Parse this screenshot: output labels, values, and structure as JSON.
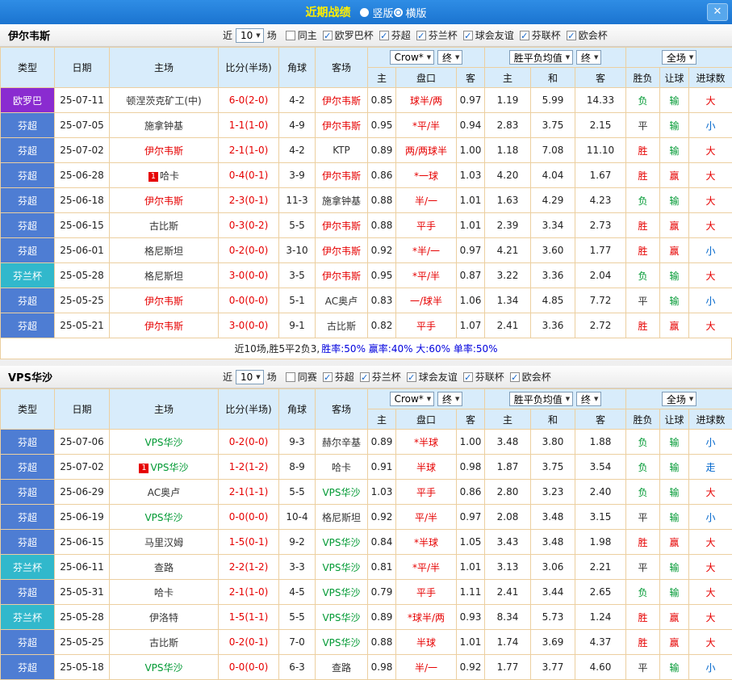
{
  "titlebar": {
    "title": "近期战绩",
    "close_glyph": "✕",
    "radios": [
      {
        "label": "竖版",
        "selected": false
      },
      {
        "label": "横版",
        "selected": true
      }
    ]
  },
  "colors": {
    "type": {
      "欧罗巴": "#8a2bd0",
      "芬超": "#4e7dd3",
      "芬兰杯": "#31b8cc"
    },
    "result": {
      "胜": "#e60000",
      "平": "#333333",
      "负": "#009933",
      "赢": "#e60000",
      "输": "#009933",
      "走": "#0066cc",
      "大": "#e60000",
      "小": "#0066cc"
    },
    "score": "#e60000",
    "handicap": "#e60000"
  },
  "table_header": {
    "type": "类型",
    "date": "日期",
    "home": "主场",
    "score": "比分(半场)",
    "corners": "角球",
    "away": "客场",
    "odds_company": "Crow*",
    "final1": "终",
    "odds_home": "主",
    "odds_handicap": "盘口",
    "odds_away": "客",
    "avg_company": "胜平负均值",
    "final2": "终",
    "avg_home": "主",
    "avg_draw": "和",
    "avg_away": "客",
    "fullmatch": "全场",
    "res_wdl": "胜负",
    "res_handicap": "让球",
    "res_goals": "进球数"
  },
  "sections": [
    {
      "team": "伊尔韦斯",
      "focus_color": "#e60000",
      "near_label": "近",
      "count_value": "10",
      "matches_label": "场",
      "filters": [
        {
          "label": "同主",
          "checked": false
        },
        {
          "label": "欧罗巴杯",
          "checked": true
        },
        {
          "label": "芬超",
          "checked": true
        },
        {
          "label": "芬兰杯",
          "checked": true
        },
        {
          "label": "球会友谊",
          "checked": true
        },
        {
          "label": "芬联杯",
          "checked": true
        },
        {
          "label": "欧会杯",
          "checked": true
        }
      ],
      "rows": [
        {
          "type": "欧罗巴",
          "date": "25-07-11",
          "home": "顿涅茨克矿工(中)",
          "home_badge": "",
          "home_focus": false,
          "score": "6-0(2-0)",
          "corners": "4-2",
          "away": "伊尔韦斯",
          "away_focus": true,
          "o_home": "0.85",
          "handicap": "球半/两",
          "o_away": "0.97",
          "a_home": "1.19",
          "a_draw": "5.99",
          "a_away": "14.33",
          "r_wdl": "负",
          "r_let": "输",
          "r_goal": "大"
        },
        {
          "type": "芬超",
          "date": "25-07-05",
          "home": "施拿钟基",
          "home_badge": "",
          "home_focus": false,
          "score": "1-1(1-0)",
          "corners": "4-9",
          "away": "伊尔韦斯",
          "away_focus": true,
          "o_home": "0.95",
          "handicap": "*平/半",
          "o_away": "0.94",
          "a_home": "2.83",
          "a_draw": "3.75",
          "a_away": "2.15",
          "r_wdl": "平",
          "r_let": "输",
          "r_goal": "小"
        },
        {
          "type": "芬超",
          "date": "25-07-02",
          "home": "伊尔韦斯",
          "home_badge": "",
          "home_focus": true,
          "score": "2-1(1-0)",
          "corners": "4-2",
          "away": "KTP",
          "away_focus": false,
          "o_home": "0.89",
          "handicap": "两/两球半",
          "o_away": "1.00",
          "a_home": "1.18",
          "a_draw": "7.08",
          "a_away": "11.10",
          "r_wdl": "胜",
          "r_let": "输",
          "r_goal": "大"
        },
        {
          "type": "芬超",
          "date": "25-06-28",
          "home": "哈卡",
          "home_badge": "1",
          "home_focus": false,
          "score": "0-4(0-1)",
          "corners": "3-9",
          "away": "伊尔韦斯",
          "away_focus": true,
          "o_home": "0.86",
          "handicap": "*一球",
          "o_away": "1.03",
          "a_home": "4.20",
          "a_draw": "4.04",
          "a_away": "1.67",
          "r_wdl": "胜",
          "r_let": "赢",
          "r_goal": "大"
        },
        {
          "type": "芬超",
          "date": "25-06-18",
          "home": "伊尔韦斯",
          "home_badge": "",
          "home_focus": true,
          "score": "2-3(0-1)",
          "corners": "11-3",
          "away": "施拿钟基",
          "away_focus": false,
          "o_home": "0.88",
          "handicap": "半/一",
          "o_away": "1.01",
          "a_home": "1.63",
          "a_draw": "4.29",
          "a_away": "4.23",
          "r_wdl": "负",
          "r_let": "输",
          "r_goal": "大"
        },
        {
          "type": "芬超",
          "date": "25-06-15",
          "home": "古比斯",
          "home_badge": "",
          "home_focus": false,
          "score": "0-3(0-2)",
          "corners": "5-5",
          "away": "伊尔韦斯",
          "away_focus": true,
          "o_home": "0.88",
          "handicap": "平手",
          "o_away": "1.01",
          "a_home": "2.39",
          "a_draw": "3.34",
          "a_away": "2.73",
          "r_wdl": "胜",
          "r_let": "赢",
          "r_goal": "大"
        },
        {
          "type": "芬超",
          "date": "25-06-01",
          "home": "格尼斯坦",
          "home_badge": "",
          "home_focus": false,
          "score": "0-2(0-0)",
          "corners": "3-10",
          "away": "伊尔韦斯",
          "away_focus": true,
          "o_home": "0.92",
          "handicap": "*半/一",
          "o_away": "0.97",
          "a_home": "4.21",
          "a_draw": "3.60",
          "a_away": "1.77",
          "r_wdl": "胜",
          "r_let": "赢",
          "r_goal": "小"
        },
        {
          "type": "芬兰杯",
          "date": "25-05-28",
          "home": "格尼斯坦",
          "home_badge": "",
          "home_focus": false,
          "score": "3-0(0-0)",
          "corners": "3-5",
          "away": "伊尔韦斯",
          "away_focus": true,
          "o_home": "0.95",
          "handicap": "*平/半",
          "o_away": "0.87",
          "a_home": "3.22",
          "a_draw": "3.36",
          "a_away": "2.04",
          "r_wdl": "负",
          "r_let": "输",
          "r_goal": "大"
        },
        {
          "type": "芬超",
          "date": "25-05-25",
          "home": "伊尔韦斯",
          "home_badge": "",
          "home_focus": true,
          "score": "0-0(0-0)",
          "corners": "5-1",
          "away": "AC奥卢",
          "away_focus": false,
          "o_home": "0.83",
          "handicap": "一/球半",
          "o_away": "1.06",
          "a_home": "1.34",
          "a_draw": "4.85",
          "a_away": "7.72",
          "r_wdl": "平",
          "r_let": "输",
          "r_goal": "小"
        },
        {
          "type": "芬超",
          "date": "25-05-21",
          "home": "伊尔韦斯",
          "home_badge": "",
          "home_focus": true,
          "score": "3-0(0-0)",
          "corners": "9-1",
          "away": "古比斯",
          "away_focus": false,
          "o_home": "0.82",
          "handicap": "平手",
          "o_away": "1.07",
          "a_home": "2.41",
          "a_draw": "3.36",
          "a_away": "2.72",
          "r_wdl": "胜",
          "r_let": "赢",
          "r_goal": "大"
        }
      ],
      "summary_prefix": "近10场,胜5平2负3, ",
      "summary_stats": "胜率:50% 赢率:40% 大:60% 单率:50%"
    },
    {
      "team": "VPS华沙",
      "focus_color": "#009933",
      "near_label": "近",
      "count_value": "10",
      "matches_label": "场",
      "filters": [
        {
          "label": "同赛",
          "checked": false
        },
        {
          "label": "芬超",
          "checked": true
        },
        {
          "label": "芬兰杯",
          "checked": true
        },
        {
          "label": "球会友谊",
          "checked": true
        },
        {
          "label": "芬联杯",
          "checked": true
        },
        {
          "label": "欧会杯",
          "checked": true
        }
      ],
      "rows": [
        {
          "type": "芬超",
          "date": "25-07-06",
          "home": "VPS华沙",
          "home_badge": "",
          "home_focus": true,
          "score": "0-2(0-0)",
          "corners": "9-3",
          "away": "赫尔辛基",
          "away_focus": false,
          "o_home": "0.89",
          "handicap": "*半球",
          "o_away": "1.00",
          "a_home": "3.48",
          "a_draw": "3.80",
          "a_away": "1.88",
          "r_wdl": "负",
          "r_let": "输",
          "r_goal": "小"
        },
        {
          "type": "芬超",
          "date": "25-07-02",
          "home": "VPS华沙",
          "home_badge": "1",
          "home_focus": true,
          "score": "1-2(1-2)",
          "corners": "8-9",
          "away": "哈卡",
          "away_focus": false,
          "o_home": "0.91",
          "handicap": "半球",
          "o_away": "0.98",
          "a_home": "1.87",
          "a_draw": "3.75",
          "a_away": "3.54",
          "r_wdl": "负",
          "r_let": "输",
          "r_goal": "走"
        },
        {
          "type": "芬超",
          "date": "25-06-29",
          "home": "AC奥卢",
          "home_badge": "",
          "home_focus": false,
          "score": "2-1(1-1)",
          "corners": "5-5",
          "away": "VPS华沙",
          "away_focus": true,
          "o_home": "1.03",
          "handicap": "平手",
          "o_away": "0.86",
          "a_home": "2.80",
          "a_draw": "3.23",
          "a_away": "2.40",
          "r_wdl": "负",
          "r_let": "输",
          "r_goal": "大"
        },
        {
          "type": "芬超",
          "date": "25-06-19",
          "home": "VPS华沙",
          "home_badge": "",
          "home_focus": true,
          "score": "0-0(0-0)",
          "corners": "10-4",
          "away": "格尼斯坦",
          "away_focus": false,
          "o_home": "0.92",
          "handicap": "平/半",
          "o_away": "0.97",
          "a_home": "2.08",
          "a_draw": "3.48",
          "a_away": "3.15",
          "r_wdl": "平",
          "r_let": "输",
          "r_goal": "小"
        },
        {
          "type": "芬超",
          "date": "25-06-15",
          "home": "马里汉姆",
          "home_badge": "",
          "home_focus": false,
          "score": "1-5(0-1)",
          "corners": "9-2",
          "away": "VPS华沙",
          "away_focus": true,
          "o_home": "0.84",
          "handicap": "*半球",
          "o_away": "1.05",
          "a_home": "3.43",
          "a_draw": "3.48",
          "a_away": "1.98",
          "r_wdl": "胜",
          "r_let": "赢",
          "r_goal": "大"
        },
        {
          "type": "芬兰杯",
          "date": "25-06-11",
          "home": "查路",
          "home_badge": "",
          "home_focus": false,
          "score": "2-2(1-2)",
          "corners": "3-3",
          "away": "VPS华沙",
          "away_focus": true,
          "o_home": "0.81",
          "handicap": "*平/半",
          "o_away": "1.01",
          "a_home": "3.13",
          "a_draw": "3.06",
          "a_away": "2.21",
          "r_wdl": "平",
          "r_let": "输",
          "r_goal": "大"
        },
        {
          "type": "芬超",
          "date": "25-05-31",
          "home": "哈卡",
          "home_badge": "",
          "home_focus": false,
          "score": "2-1(1-0)",
          "corners": "4-5",
          "away": "VPS华沙",
          "away_focus": true,
          "o_home": "0.79",
          "handicap": "平手",
          "o_away": "1.11",
          "a_home": "2.41",
          "a_draw": "3.44",
          "a_away": "2.65",
          "r_wdl": "负",
          "r_let": "输",
          "r_goal": "大"
        },
        {
          "type": "芬兰杯",
          "date": "25-05-28",
          "home": "伊洛特",
          "home_badge": "",
          "home_focus": false,
          "score": "1-5(1-1)",
          "corners": "5-5",
          "away": "VPS华沙",
          "away_focus": true,
          "o_home": "0.89",
          "handicap": "*球半/两",
          "o_away": "0.93",
          "a_home": "8.34",
          "a_draw": "5.73",
          "a_away": "1.24",
          "r_wdl": "胜",
          "r_let": "赢",
          "r_goal": "大"
        },
        {
          "type": "芬超",
          "date": "25-05-25",
          "home": "古比斯",
          "home_badge": "",
          "home_focus": false,
          "score": "0-2(0-1)",
          "corners": "7-0",
          "away": "VPS华沙",
          "away_focus": true,
          "o_home": "0.88",
          "handicap": "半球",
          "o_away": "1.01",
          "a_home": "1.74",
          "a_draw": "3.69",
          "a_away": "4.37",
          "r_wdl": "胜",
          "r_let": "赢",
          "r_goal": "大"
        },
        {
          "type": "芬超",
          "date": "25-05-18",
          "home": "VPS华沙",
          "home_badge": "",
          "home_focus": true,
          "score": "0-0(0-0)",
          "corners": "6-3",
          "away": "查路",
          "away_focus": false,
          "o_home": "0.98",
          "handicap": "半/一",
          "o_away": "0.92",
          "a_home": "1.77",
          "a_draw": "3.77",
          "a_away": "4.60",
          "r_wdl": "平",
          "r_let": "输",
          "r_goal": "小"
        }
      ]
    }
  ]
}
